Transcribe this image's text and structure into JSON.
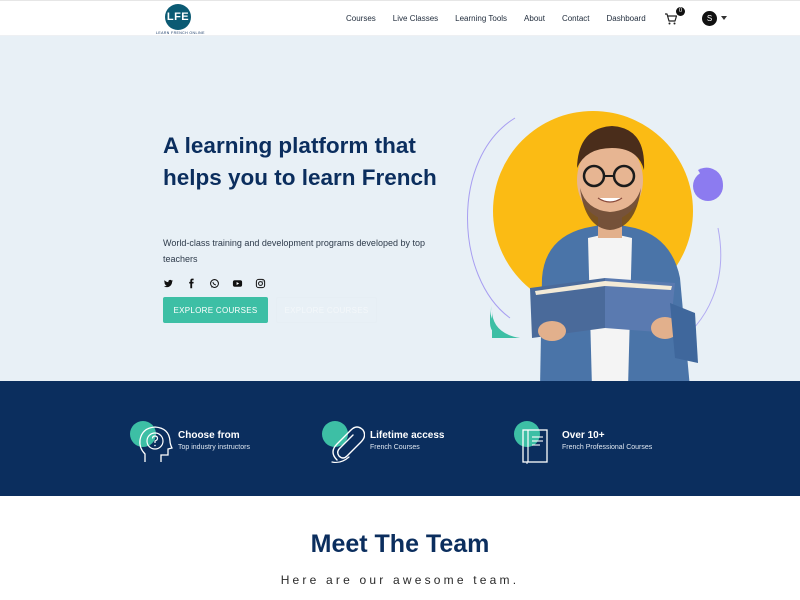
{
  "navbar": {
    "logo_text": "LFE",
    "logo_subtitle": "LEARN FRENCH ONLINE",
    "links": [
      "Courses",
      "Live Classes",
      "Learning Tools",
      "About",
      "Contact",
      "Dashboard"
    ],
    "cart_count": "0",
    "avatar_initial": "S"
  },
  "hero": {
    "title": "A learning platform that helps you to learn French",
    "subtitle": "World-class training and development programs developed by top teachers",
    "socials": [
      "twitter-icon",
      "facebook-icon",
      "whatsapp-icon",
      "youtube-icon",
      "instagram-icon"
    ],
    "primary_button": "EXPLORE COURSES",
    "secondary_button": "EXPLORE COURSES"
  },
  "features": [
    {
      "title": "Choose from",
      "subtitle": "Top industry instructors",
      "icon": "head-question-icon"
    },
    {
      "title": "Lifetime access",
      "subtitle": "French Courses",
      "icon": "paperclip-icon"
    },
    {
      "title": "Over 10+",
      "subtitle": "French Professional Courses",
      "icon": "book-icon"
    }
  ],
  "team": {
    "title": "Meet The Team",
    "subtitle": "Here are our awesome team."
  },
  "colors": {
    "navy": "#0b2e5e",
    "teal": "#3dbfa5",
    "yellow": "#fbbb14",
    "purple": "#8c7bf0",
    "hero_bg": "#e8f0f6"
  }
}
